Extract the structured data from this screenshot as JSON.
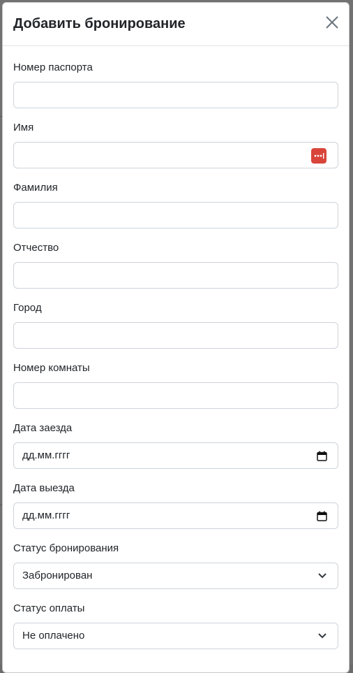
{
  "modal": {
    "title": "Добавить бронирование",
    "close_icon": "close-icon"
  },
  "fields": {
    "passport": {
      "label": "Номер паспорта",
      "value": ""
    },
    "first_name": {
      "label": "Имя",
      "value": "",
      "icon": "password-manager-icon"
    },
    "last_name": {
      "label": "Фамилия",
      "value": ""
    },
    "patronymic": {
      "label": "Отчество",
      "value": ""
    },
    "city": {
      "label": "Город",
      "value": ""
    },
    "room_number": {
      "label": "Номер комнаты",
      "value": ""
    },
    "check_in": {
      "label": "Дата заезда",
      "value": "дд.мм.гггг",
      "icon": "calendar-icon"
    },
    "check_out": {
      "label": "Дата выезда",
      "value": "дд.мм.гггг",
      "icon": "calendar-icon"
    },
    "booking_status": {
      "label": "Статус бронирования",
      "value": "Забронирован",
      "icon": "chevron-down-icon"
    },
    "payment_status": {
      "label": "Статус оплаты",
      "value": "Не оплачено",
      "icon": "chevron-down-icon"
    }
  },
  "colors": {
    "accent_icon": "#d9453b",
    "border": "#ced4da",
    "text": "#212529"
  }
}
